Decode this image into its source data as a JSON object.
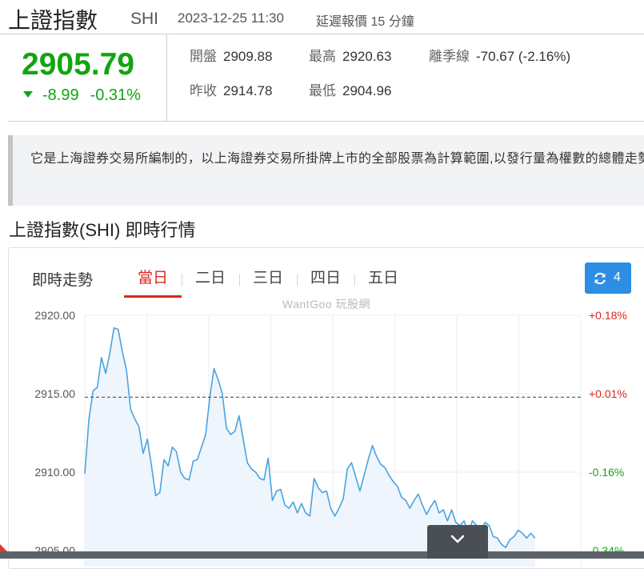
{
  "header": {
    "name": "上證指數",
    "code": "SHI",
    "datetime": "2023-12-25 11:30",
    "delay_note": "延遲報價 15 分鐘"
  },
  "quote": {
    "price": "2905.79",
    "change": "-8.99",
    "change_pct": "-0.31%",
    "stats": [
      {
        "label": "開盤",
        "value": "2909.88"
      },
      {
        "label": "最高",
        "value": "2920.63"
      },
      {
        "label": "離季線",
        "value": "-70.67 (-2.16%)"
      },
      {
        "label": "昨收",
        "value": "2914.78"
      },
      {
        "label": "最低",
        "value": "2904.96"
      }
    ]
  },
  "description": "它是上海證券交易所編制的，以上海證券交易所掛牌上市的全部股票為計算範圍,以發行量為權數的總體走勢。",
  "section_title": "上證指數(SHI) 即時行情",
  "chart_panel": {
    "title": "即時走勢",
    "tabs": [
      "當日",
      "二日",
      "三日",
      "四日",
      "五日"
    ],
    "active_tab": 0,
    "refresh_label": "4",
    "refresh_icon": "refresh-icon",
    "watermark": "WantGoo 玩股網",
    "expand_icon": "chevron-down-icon"
  },
  "colors": {
    "up": "#d8281f",
    "down": "#12a512",
    "line": "#4aa3df",
    "accent": "#2d8ee3"
  },
  "chart_data": {
    "type": "area",
    "title": "",
    "xlabel": "",
    "ylabel": "",
    "ylim": [
      2905.0,
      2920.0
    ],
    "y_ticks": [
      "2920.00",
      "2915.00",
      "2910.00",
      "2905.00"
    ],
    "right_ticks": [
      {
        "value": 2920.0,
        "label": "+0.18%",
        "color": "#d8281f"
      },
      {
        "value": 2915.0,
        "label": "+0.01%",
        "color": "#d8281f"
      },
      {
        "value": 2910.0,
        "label": "-0.16%",
        "color": "#12a512"
      },
      {
        "value": 2905.0,
        "label": "-0.34%",
        "color": "#12a512"
      }
    ],
    "reference_line": {
      "value": 2914.78,
      "style": "dashed"
    },
    "grid": true,
    "vertical_gridlines": 8,
    "session_points_total": 120,
    "series": [
      {
        "values": [
          2909.9,
          2913.4,
          2915.2,
          2915.4,
          2917.3,
          2916.3,
          2917.6,
          2919.2,
          2919.1,
          2917.7,
          2916.5,
          2914.0,
          2913.4,
          2912.9,
          2911.2,
          2912.1,
          2910.4,
          2908.5,
          2908.7,
          2910.8,
          2910.4,
          2911.6,
          2911.3,
          2910.0,
          2909.6,
          2909.5,
          2910.7,
          2910.8,
          2911.6,
          2912.4,
          2914.8,
          2916.6,
          2915.9,
          2915.0,
          2912.8,
          2912.4,
          2912.6,
          2913.6,
          2912.1,
          2910.6,
          2910.2,
          2910.0,
          2909.6,
          2909.5,
          2910.9,
          2908.2,
          2908.8,
          2908.9,
          2907.9,
          2907.7,
          2908.1,
          2907.4,
          2908.0,
          2907.4,
          2907.2,
          2909.6,
          2909.0,
          2908.7,
          2908.8,
          2907.7,
          2907.2,
          2907.7,
          2908.3,
          2910.2,
          2910.6,
          2909.7,
          2908.8,
          2909.8,
          2910.8,
          2911.7,
          2911.0,
          2910.5,
          2910.3,
          2909.8,
          2909.4,
          2909.1,
          2908.4,
          2908.2,
          2907.7,
          2908.2,
          2908.6,
          2907.9,
          2907.3,
          2907.8,
          2908.2,
          2907.4,
          2907.6,
          2906.9,
          2907.6,
          2906.8,
          2906.6,
          2906.9,
          2906.1,
          2906.9,
          2906.6,
          2906.1,
          2906.8,
          2906.6,
          2905.9,
          2905.8,
          2905.4,
          2905.2,
          2905.7,
          2905.9,
          2906.3,
          2906.1,
          2905.8,
          2906.1,
          2905.8
        ]
      }
    ]
  }
}
